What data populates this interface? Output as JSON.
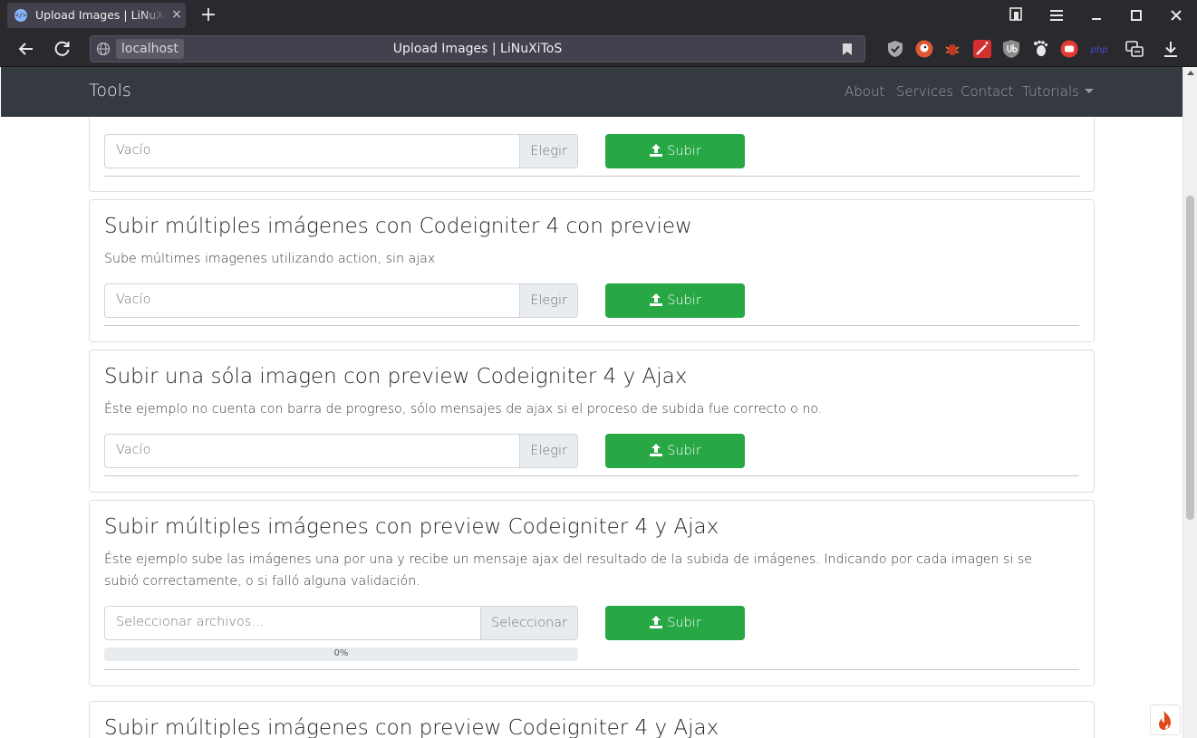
{
  "browser": {
    "tab_title": "Upload Images | LiNuXiToS",
    "tab_favicon": "</>",
    "tab_close": "×",
    "new_tab": "+",
    "url_host": "localhost",
    "url_title": "Upload Images | LiNuXiToS",
    "icons": [
      "back-arrow-icon",
      "reload-icon",
      "globe-icon",
      "bookmark-icon",
      "tab-manager-icon",
      "menu-icon",
      "minimize-icon",
      "maximize-icon",
      "close-icon",
      "download-icon",
      "screenshot-icon"
    ],
    "extensions": [
      "shield-extension-icon",
      "duckduckgo-extension-icon",
      "bug-extension-icon",
      "wand-extension-icon",
      "ublock-extension-icon",
      "gnome-extension-icon",
      "toggle-extension-icon",
      "php-extension-icon"
    ],
    "ext_php_label": "php"
  },
  "site": {
    "brand": "Tools",
    "nav": [
      "About",
      "Services",
      "Contact",
      "Tutorials"
    ]
  },
  "cards": [
    {
      "title": "",
      "description": "",
      "placeholder": "Vacío",
      "choose": "Elegir",
      "submit": "Subir"
    },
    {
      "title": "Subir múltiples imágenes con Codeigniter 4 con preview",
      "description": "Sube múltimes imagenes utilizando action, sin ajax",
      "placeholder": "Vacío",
      "choose": "Elegir",
      "submit": "Subir"
    },
    {
      "title": "Subir una sóla imagen con preview Codeigniter 4 y Ajax",
      "description": "Éste ejemplo no cuenta con barra de progreso, sólo mensajes de ajax si el proceso de subida fue correcto o no.",
      "placeholder": "Vacío",
      "choose": "Elegir",
      "submit": "Subir"
    },
    {
      "title": "Subir múltiples imágenes con preview Codeigniter 4 y Ajax",
      "description": "Éste ejemplo sube las imágenes una por una y recibe un mensaje ajax del resultado de la subida de imágenes. Indicando por cada imagen si se subió correctamente, o si falló alguna validación.",
      "placeholder": "Seleccionar archivos...",
      "choose": "Seleccionar",
      "submit": "Subir",
      "progress_label": "0%",
      "progress_value": 0
    },
    {
      "title": "Subir múltiples imágenes con preview Codeigniter 4 y Ajax"
    }
  ],
  "colors": {
    "success": "#28a745",
    "navbar": "#343a40",
    "browser_chrome": "#2a2a2e",
    "upload_icon": "upload-icon",
    "debug_toolbar_icon": "codeigniter-flame-icon"
  }
}
